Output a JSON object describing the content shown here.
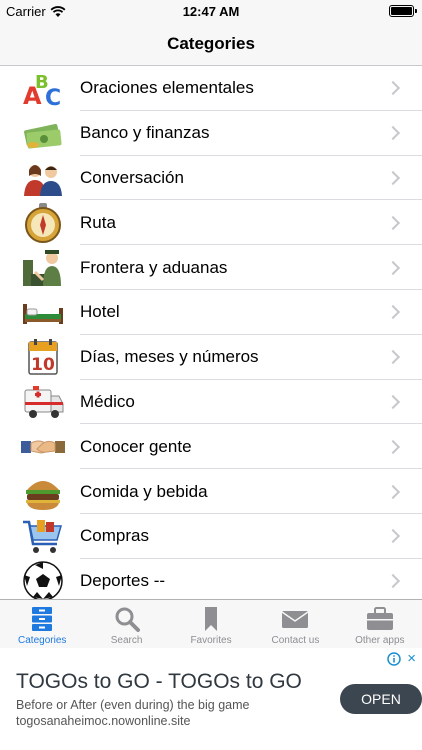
{
  "status": {
    "carrier": "Carrier",
    "time": "12:47 AM"
  },
  "nav": {
    "title": "Categories"
  },
  "categories": [
    {
      "label": "Oraciones elementales",
      "icon": "abc-blocks-icon"
    },
    {
      "label": "Banco y finanzas",
      "icon": "money-icon"
    },
    {
      "label": "Conversación",
      "icon": "people-talking-icon"
    },
    {
      "label": "Ruta",
      "icon": "compass-icon"
    },
    {
      "label": "Frontera y aduanas",
      "icon": "customs-officer-icon"
    },
    {
      "label": "Hotel",
      "icon": "bed-icon"
    },
    {
      "label": "Días, meses y números",
      "icon": "calendar-icon"
    },
    {
      "label": "Médico",
      "icon": "ambulance-icon"
    },
    {
      "label": "Conocer gente",
      "icon": "handshake-icon"
    },
    {
      "label": "Comida y bebida",
      "icon": "burger-icon"
    },
    {
      "label": "Compras",
      "icon": "shopping-cart-icon"
    },
    {
      "label": "Deportes --",
      "icon": "soccer-ball-icon"
    }
  ],
  "calendar_number": "10",
  "tabs": [
    {
      "label": "Categories",
      "icon": "categories-icon",
      "active": true
    },
    {
      "label": "Search",
      "icon": "search-icon",
      "active": false
    },
    {
      "label": "Favorites",
      "icon": "bookmark-icon",
      "active": false
    },
    {
      "label": "Contact us",
      "icon": "envelope-icon",
      "active": false
    },
    {
      "label": "Other apps",
      "icon": "briefcase-icon",
      "active": false
    }
  ],
  "ad": {
    "title": "TOGOs to GO - TOGOs to GO",
    "subtitle": "Before or After (even during) the big game",
    "url": "togosanaheimoc.nowonline.site",
    "button": "OPEN",
    "close": "×"
  },
  "colors": {
    "accent": "#1f7ae0",
    "tab_inactive": "#8e8e93",
    "separator": "#dcdce0"
  }
}
